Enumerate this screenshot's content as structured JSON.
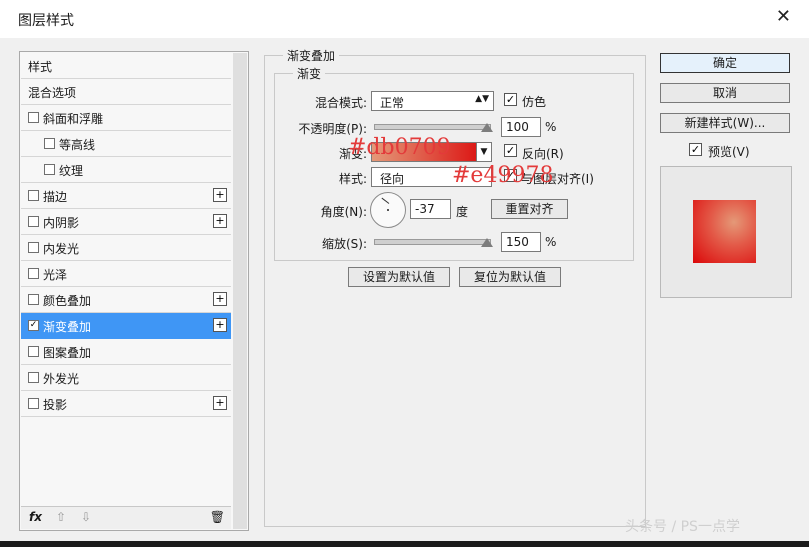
{
  "window": {
    "title": "图层样式",
    "close_glyph": "✕"
  },
  "sidebar": {
    "items": [
      {
        "label": "样式"
      },
      {
        "label": "混合选项"
      },
      {
        "label": "斜面和浮雕",
        "checked": false
      },
      {
        "label": "等高线",
        "checked": false
      },
      {
        "label": "纹理",
        "checked": false
      },
      {
        "label": "描边",
        "checked": false,
        "plus": "+"
      },
      {
        "label": "内阴影",
        "checked": false,
        "plus": "+"
      },
      {
        "label": "内发光",
        "checked": false
      },
      {
        "label": "光泽",
        "checked": false
      },
      {
        "label": "颜色叠加",
        "checked": false,
        "plus": "+"
      },
      {
        "label": "渐变叠加",
        "checked": true,
        "plus": "+",
        "active": true
      },
      {
        "label": "图案叠加",
        "checked": false
      },
      {
        "label": "外发光",
        "checked": false
      },
      {
        "label": "投影",
        "checked": false,
        "plus": "+"
      }
    ],
    "bottom": {
      "fx": "fx",
      "up": "⇧",
      "down": "⇩",
      "trash": "🗑"
    }
  },
  "main": {
    "section_title": "渐变叠加",
    "group_title": "渐变",
    "blend_mode": {
      "label": "混合模式:",
      "value": "正常"
    },
    "dither": {
      "label": "仿色",
      "checked": true
    },
    "opacity": {
      "label": "不透明度(P):",
      "value": "100",
      "unit": "%"
    },
    "gradient": {
      "label": "渐变:"
    },
    "reverse": {
      "label": "反向(R)",
      "checked": true
    },
    "style": {
      "label": "样式:",
      "value": "径向"
    },
    "align_layer": {
      "label": "与图层对齐(I)",
      "checked": true
    },
    "angle": {
      "label": "角度(N):",
      "value": "-37",
      "unit": "度"
    },
    "reset_align": "重置对齐",
    "scale": {
      "label": "缩放(S):",
      "value": "150",
      "unit": "%"
    },
    "set_default": "设置为默认值",
    "reset_default": "复位为默认值"
  },
  "right": {
    "ok": "确定",
    "cancel": "取消",
    "new_style": "新建样式(W)...",
    "preview": {
      "label": "预览(V)",
      "checked": true
    }
  },
  "annotations": {
    "color1": "#db0709",
    "color2": "#e49978"
  },
  "colors": {
    "active_row": "#3f96f5",
    "grad_start": "#db0709",
    "grad_end": "#e49978"
  },
  "watermark": "头条号 / PS一点学"
}
